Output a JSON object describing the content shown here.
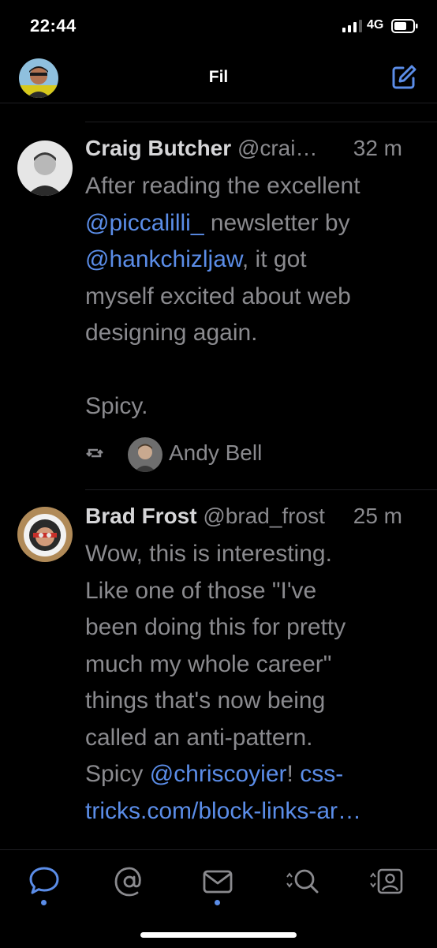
{
  "status_bar": {
    "time": "22:44",
    "network": "4G"
  },
  "header": {
    "title": "Fil",
    "left_icon": "profile-avatar",
    "right_icon": "compose-icon"
  },
  "tweets": [
    {
      "author": "Craig Butcher",
      "handle": "@crai…",
      "time": "32 m",
      "text_parts": [
        "After reading the excellent\n",
        "@piccalilli_",
        " newsletter by\n",
        "@hankchizljaw",
        ", it got\nmyself excited about web\ndesigning again.\n\nSpicy."
      ],
      "retweeted_by": "Andy Bell"
    },
    {
      "author": "Brad Frost",
      "handle": "@brad_frost",
      "time": "25 m",
      "text_parts": [
        "Wow, this is interesting.\nLike one of those \"I've\nbeen doing this for pretty\nmuch my whole career\"\nthings that's now being\ncalled an anti-pattern.\nSpicy ",
        "@chriscoyier",
        "! ",
        "css-\ntricks.com/block-links-ar…"
      ]
    }
  ],
  "tabs": [
    {
      "name": "timeline-tab",
      "icon": "chat-bubble-icon",
      "active": true
    },
    {
      "name": "mentions-tab",
      "icon": "at-icon",
      "active": false
    },
    {
      "name": "messages-tab",
      "icon": "envelope-icon",
      "active": false
    },
    {
      "name": "search-tab",
      "icon": "search-icon",
      "active": false
    },
    {
      "name": "profile-tab",
      "icon": "profile-card-icon",
      "active": false
    }
  ],
  "colors": {
    "background": "#000000",
    "text": "#8a8a8e",
    "name": "#d6d6d8",
    "accent": "#5b8de8"
  }
}
